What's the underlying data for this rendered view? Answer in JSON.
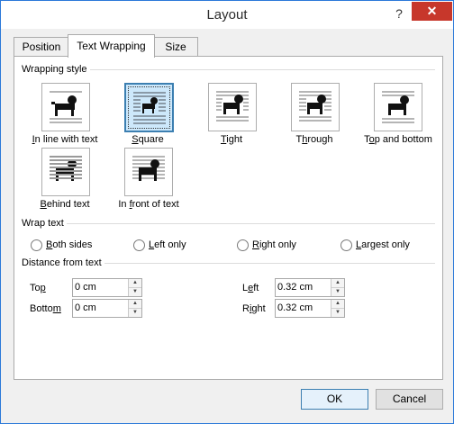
{
  "window": {
    "title": "Layout",
    "help_label": "?",
    "close_label": "✕"
  },
  "tabs": [
    {
      "label": "Position"
    },
    {
      "label": "Text Wrapping"
    },
    {
      "label": "Size"
    }
  ],
  "active_tab": "Text Wrapping",
  "wrapping_style": {
    "heading": "Wrapping style",
    "selected": "Square",
    "options": [
      {
        "prefix": "",
        "mnemonic": "I",
        "rest": "n line with text",
        "icon": "inline-with-text-icon"
      },
      {
        "prefix": "",
        "mnemonic": "S",
        "rest": "quare",
        "icon": "square-wrap-icon"
      },
      {
        "prefix": "",
        "mnemonic": "T",
        "rest": "ight",
        "icon": "tight-wrap-icon"
      },
      {
        "prefix": "T",
        "mnemonic": "h",
        "rest": "rough",
        "icon": "through-wrap-icon"
      },
      {
        "prefix": "T",
        "mnemonic": "o",
        "rest": "p and bottom",
        "icon": "top-bottom-wrap-icon"
      },
      {
        "prefix": "",
        "mnemonic": "B",
        "rest": "ehind text",
        "icon": "behind-text-icon"
      },
      {
        "prefix": "In ",
        "mnemonic": "f",
        "rest": "ront of text",
        "icon": "in-front-of-text-icon"
      }
    ]
  },
  "wrap_text": {
    "heading": "Wrap text",
    "options": [
      {
        "prefix": "",
        "mnemonic": "B",
        "rest": "oth sides",
        "checked": false
      },
      {
        "prefix": "",
        "mnemonic": "L",
        "rest": "eft only",
        "checked": false
      },
      {
        "prefix": "",
        "mnemonic": "R",
        "rest": "ight only",
        "checked": false
      },
      {
        "prefix": "",
        "mnemonic": "L",
        "rest": "argest only",
        "checked": false
      }
    ]
  },
  "distance": {
    "heading": "Distance from text",
    "top": {
      "prefix": "To",
      "mnemonic": "p",
      "rest": "",
      "value": "0 cm"
    },
    "bottom": {
      "prefix": "Botto",
      "mnemonic": "m",
      "rest": "",
      "value": "0 cm"
    },
    "left": {
      "prefix": "L",
      "mnemonic": "e",
      "rest": "ft",
      "value": "0.32 cm"
    },
    "right": {
      "prefix": "R",
      "mnemonic": "i",
      "rest": "ght",
      "value": "0.32 cm"
    }
  },
  "buttons": {
    "ok": "OK",
    "cancel": "Cancel"
  },
  "colors": {
    "accent": "#2b79d9",
    "close": "#c7372b",
    "selected_tile": "#cde8fb"
  }
}
